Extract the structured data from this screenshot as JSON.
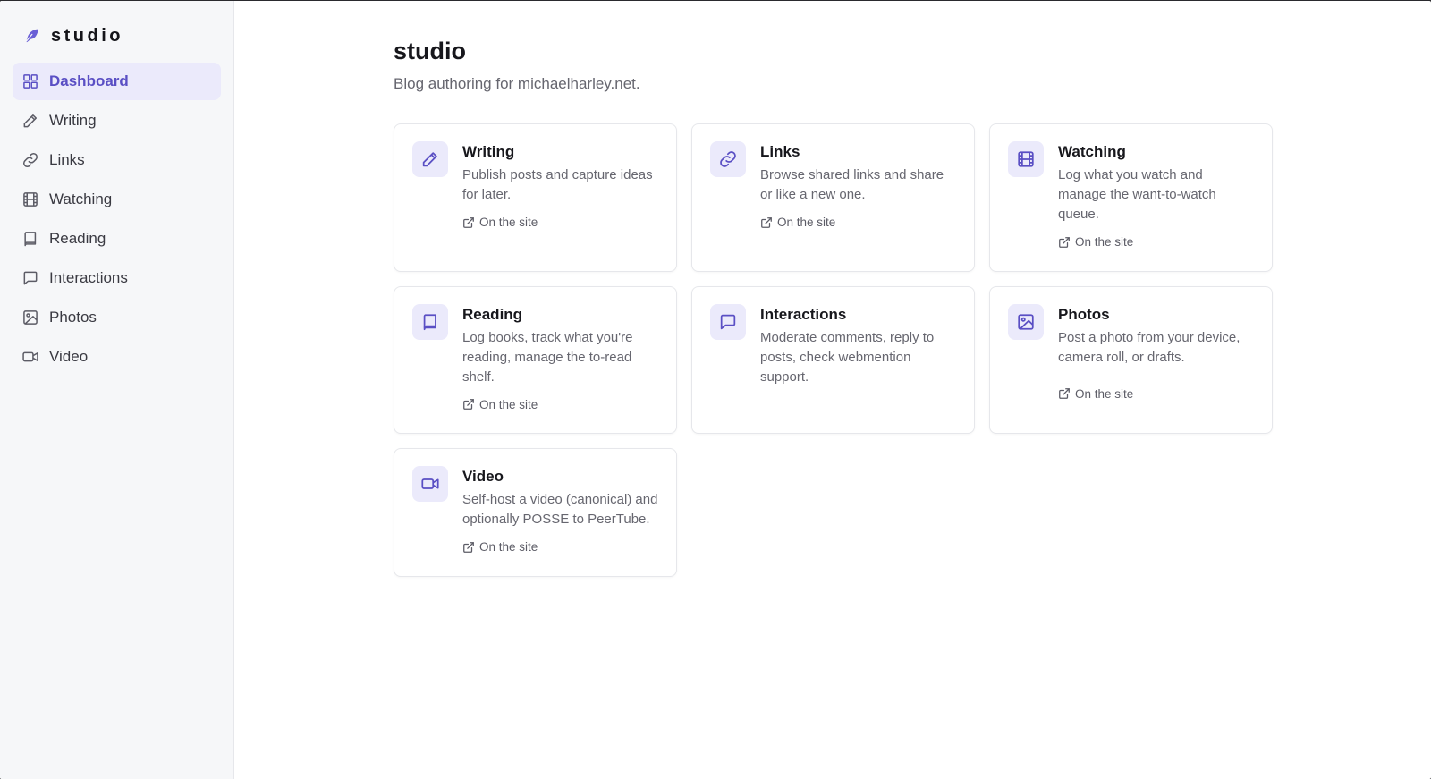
{
  "brand": {
    "name": "studio",
    "icon": "feather-icon",
    "accent": "#5a4fc4"
  },
  "sidebar": {
    "items": [
      {
        "label": "Dashboard",
        "icon": "grid-icon",
        "active": true
      },
      {
        "label": "Writing",
        "icon": "pencil-icon"
      },
      {
        "label": "Links",
        "icon": "link-icon"
      },
      {
        "label": "Watching",
        "icon": "film-icon"
      },
      {
        "label": "Reading",
        "icon": "book-icon"
      },
      {
        "label": "Interactions",
        "icon": "message-icon"
      },
      {
        "label": "Photos",
        "icon": "image-icon"
      },
      {
        "label": "Video",
        "icon": "video-icon"
      }
    ]
  },
  "main": {
    "title": "studio",
    "subtitle": "Blog authoring for michaelharley.net.",
    "cards": [
      {
        "title": "Writing",
        "description": "Publish posts and capture ideas for later.",
        "link": "On the site",
        "icon": "pencil-icon"
      },
      {
        "title": "Links",
        "description": "Browse shared links and share or like a new one.",
        "link": "On the site",
        "icon": "link-icon"
      },
      {
        "title": "Watching",
        "description": "Log what you watch and manage the want-to-watch queue.",
        "link": "On the site",
        "icon": "film-icon"
      },
      {
        "title": "Reading",
        "description": "Log books, track what you're reading, manage the to-read shelf.",
        "link": "On the site",
        "icon": "book-icon"
      },
      {
        "title": "Interactions",
        "description": "Moderate comments, reply to posts, check webmention support.",
        "icon": "message-icon"
      },
      {
        "title": "Photos",
        "description": "Post a photo from your device, camera roll, or drafts.",
        "link": "On the site",
        "icon": "image-icon"
      },
      {
        "title": "Video",
        "description": "Self-host a video (canonical) and optionally POSSE to PeerTube.",
        "link": "On the site",
        "icon": "video-icon"
      }
    ]
  }
}
